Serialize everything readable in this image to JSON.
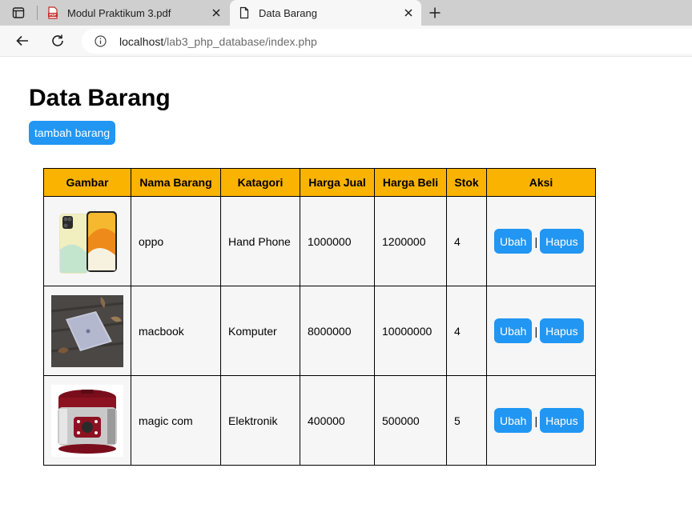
{
  "browser": {
    "tabs": [
      {
        "title": "Modul Praktikum 3.pdf",
        "icon": "pdf-file-icon",
        "active": false
      },
      {
        "title": "Data Barang",
        "icon": "document-icon",
        "active": true
      }
    ],
    "url_host": "localhost",
    "url_path": "/lab3_php_database/index.php"
  },
  "page": {
    "title": "Data Barang",
    "add_button": "tambah barang"
  },
  "table": {
    "headers": [
      "Gambar",
      "Nama Barang",
      "Katagori",
      "Harga Jual",
      "Harga Beli",
      "Stok",
      "Aksi"
    ],
    "rows": [
      {
        "image": "phone-image",
        "nama": "oppo",
        "kategori": "Hand Phone",
        "harga_jual": "1000000",
        "harga_beli": "1200000",
        "stok": "4"
      },
      {
        "image": "laptop-image",
        "nama": "macbook",
        "kategori": "Komputer",
        "harga_jual": "8000000",
        "harga_beli": "10000000",
        "stok": "4"
      },
      {
        "image": "rice-cooker-image",
        "nama": "magic com",
        "kategori": "Elektronik",
        "harga_jual": "400000",
        "harga_beli": "500000",
        "stok": "5"
      }
    ],
    "edit_label": "Ubah",
    "separator": "|",
    "delete_label": "Hapus"
  },
  "colors": {
    "accent": "#2196f3",
    "header_bg": "#fbb301",
    "row_bg": "#f6f6f6"
  }
}
